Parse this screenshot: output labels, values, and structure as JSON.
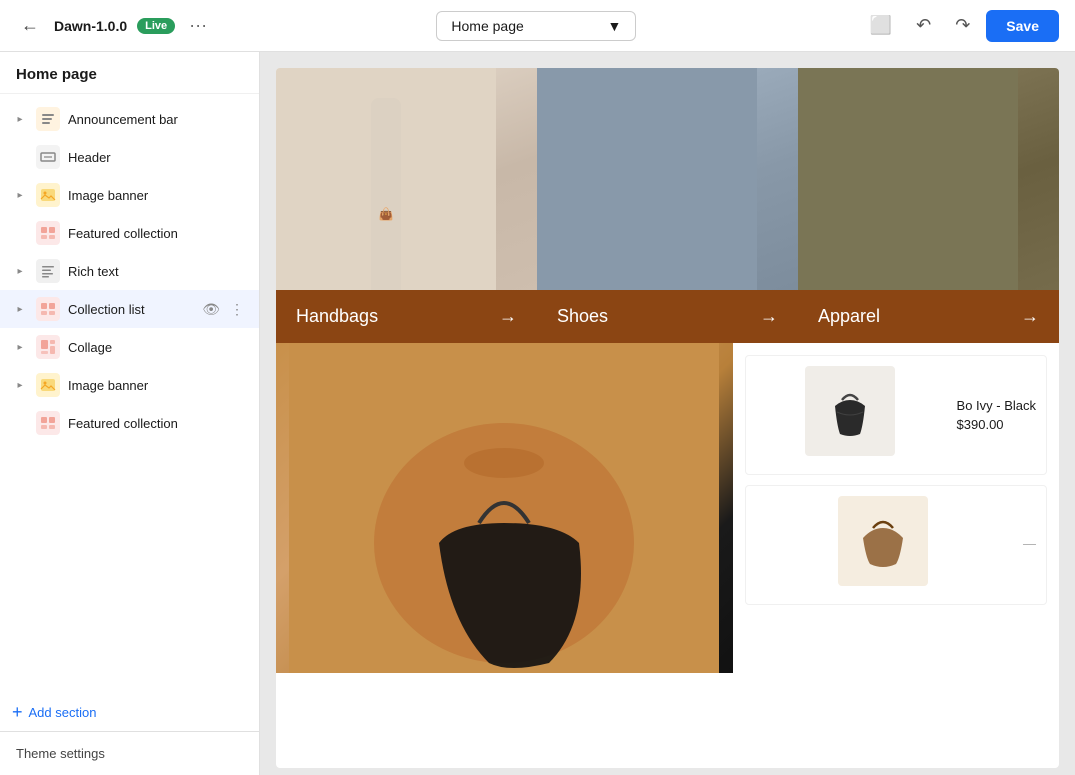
{
  "topbar": {
    "app_name": "Dawn-1.0.0",
    "live_label": "Live",
    "more_options": "···",
    "page_selector": "Home page",
    "save_label": "Save"
  },
  "sidebar": {
    "header": "Home page",
    "items": [
      {
        "id": "announcement-bar",
        "label": "Announcement bar",
        "has_chevron": true,
        "icon": "announcement"
      },
      {
        "id": "header",
        "label": "Header",
        "has_chevron": false,
        "icon": "header"
      },
      {
        "id": "image-banner",
        "label": "Image banner",
        "has_chevron": true,
        "icon": "image"
      },
      {
        "id": "featured-collection-1",
        "label": "Featured collection",
        "has_chevron": false,
        "icon": "collection"
      },
      {
        "id": "rich-text",
        "label": "Rich text",
        "has_chevron": true,
        "icon": "richtext"
      },
      {
        "id": "collection-list",
        "label": "Collection list",
        "has_chevron": true,
        "icon": "collection",
        "show_actions": true
      },
      {
        "id": "collage",
        "label": "Collage",
        "has_chevron": true,
        "icon": "collage"
      },
      {
        "id": "image-banner-2",
        "label": "Image banner",
        "has_chevron": true,
        "icon": "image"
      },
      {
        "id": "featured-collection-2",
        "label": "Featured collection",
        "has_chevron": false,
        "icon": "collection"
      }
    ],
    "add_section_label": "Add section",
    "footer_label": "Theme settings"
  },
  "canvas": {
    "collections": [
      {
        "id": "handbags",
        "label": "Handbags",
        "arrow": "→",
        "bg": "#8b4513"
      },
      {
        "id": "shoes",
        "label": "Shoes",
        "arrow": "→",
        "bg": "#8b4513"
      },
      {
        "id": "apparel",
        "label": "Apparel",
        "arrow": "→",
        "bg": "#8b4513"
      }
    ],
    "products": [
      {
        "id": "bo-ivy-black",
        "name": "Bo Ivy - Black",
        "price": "$390.00"
      },
      {
        "id": "product-2",
        "name": "",
        "price": ""
      }
    ]
  }
}
